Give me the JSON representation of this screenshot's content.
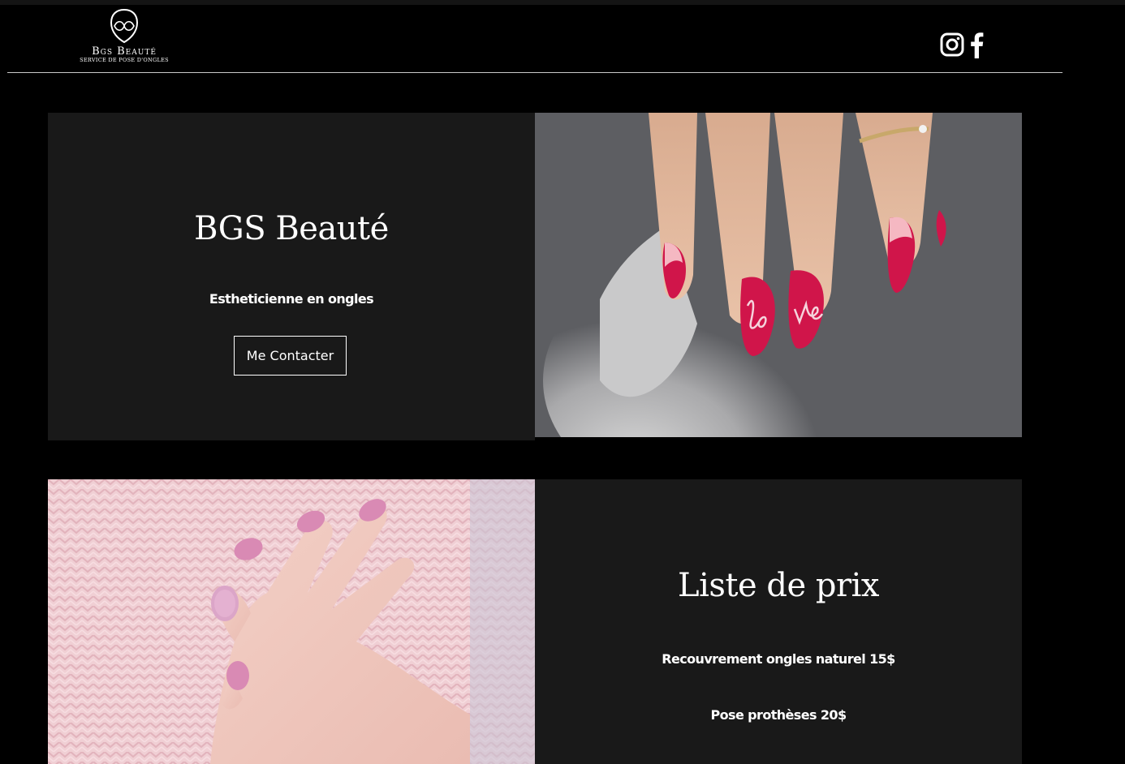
{
  "brand": {
    "name": "Bgs Beauté",
    "tagline": "Service de pose d'ongles",
    "logo_icon": "infinity-heart-icon"
  },
  "social": {
    "instagram_icon": "instagram-icon",
    "facebook_icon": "facebook-icon"
  },
  "hero": {
    "title": "BGS Beauté",
    "subtitle": "Estheticienne en ongles",
    "button_label": "Me Contacter",
    "image": "red-love-nails-photo"
  },
  "prices": {
    "title": "Liste de prix",
    "items": [
      "Recouvrement ongles naturel 15$",
      "Pose prothèses 20$"
    ],
    "image": "pink-nails-sweater-photo"
  },
  "colors": {
    "background": "#000000",
    "panel": "#191919",
    "text": "#ffffff",
    "nail_red": "#d0154a",
    "nail_pink": "#d98ab4"
  }
}
